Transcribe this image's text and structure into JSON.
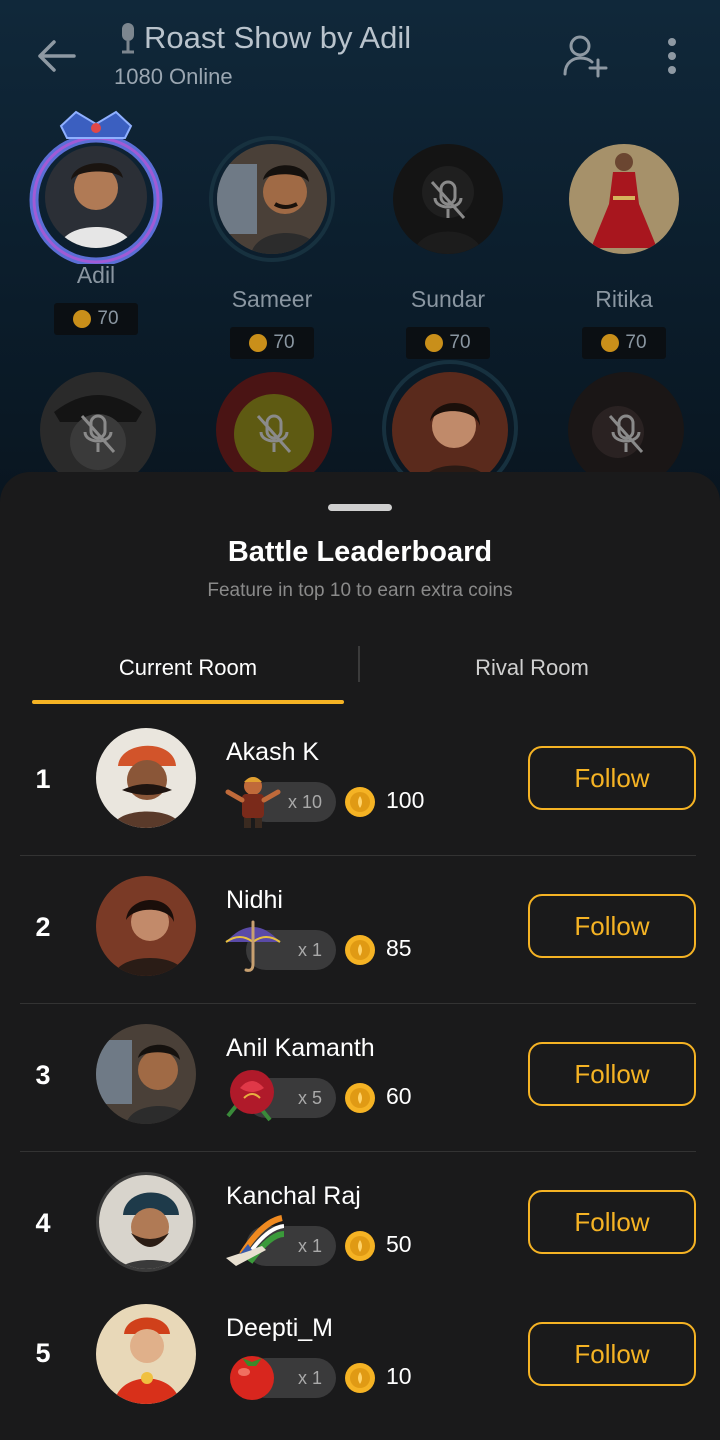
{
  "room": {
    "title": "Roast Show by Adil",
    "online": "1080 Online",
    "seats": [
      {
        "name": "Adil",
        "coins": "70",
        "muted": false
      },
      {
        "name": "Sameer",
        "coins": "70",
        "muted": false
      },
      {
        "name": "Sundar",
        "coins": "70",
        "muted": true
      },
      {
        "name": "Ritika",
        "coins": "70",
        "muted": false
      }
    ]
  },
  "sheet": {
    "title": "Battle Leaderboard",
    "subtitle": "Feature in top 10 to earn extra coins",
    "tabs": {
      "current": "Current Room",
      "rival": "Rival Room"
    }
  },
  "leaderboard": [
    {
      "rank": "1",
      "name": "Akash K",
      "gift": "dancer-gift-icon",
      "gift_count": "x 10",
      "coins": "100",
      "follow": "Follow"
    },
    {
      "rank": "2",
      "name": "Nidhi",
      "gift": "umbrella-gift-icon",
      "gift_count": "x 1",
      "coins": "85",
      "follow": "Follow"
    },
    {
      "rank": "3",
      "name": "Anil Kamanth",
      "gift": "rose-gift-icon",
      "gift_count": "x 5",
      "coins": "60",
      "follow": "Follow"
    },
    {
      "rank": "4",
      "name": "Kanchal Raj",
      "gift": "plane-gift-icon",
      "gift_count": "x 1",
      "coins": "50",
      "follow": "Follow"
    },
    {
      "rank": "5",
      "name": "Deepti_M",
      "gift": "tomato-gift-icon",
      "gift_count": "x 1",
      "coins": "10",
      "follow": "Follow"
    }
  ],
  "colors": {
    "accent": "#f5b324",
    "sheet_bg": "#1a1a1b",
    "room_bg": "#10283a"
  }
}
